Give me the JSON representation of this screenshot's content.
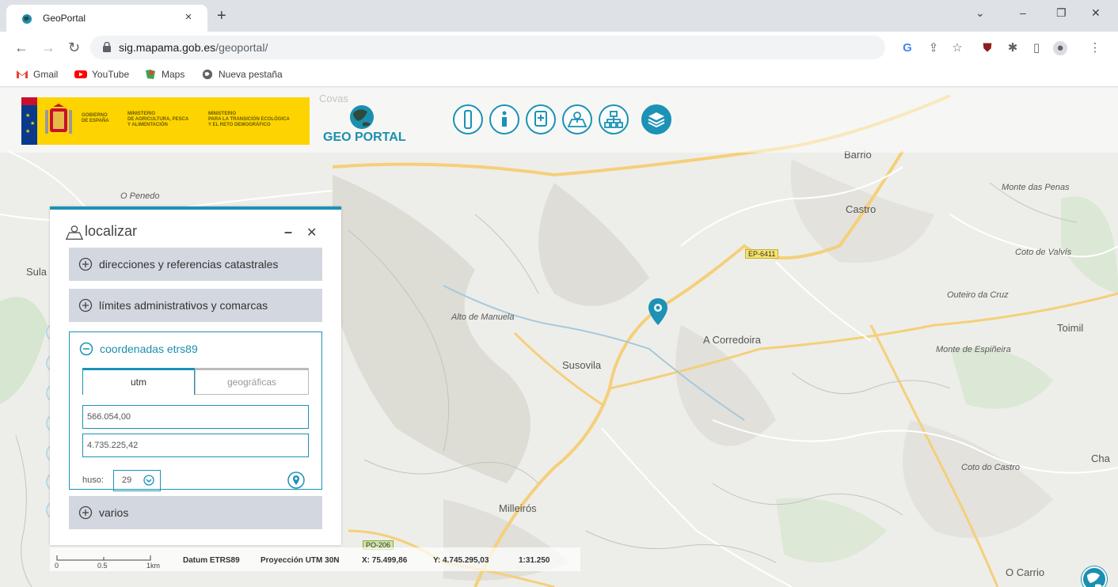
{
  "browser": {
    "tab_title": "GeoPortal",
    "tab_close": "×",
    "new_tab": "+",
    "window_controls": [
      "⌄",
      "–",
      "❐",
      "✕"
    ],
    "url_domain": "sig.mapama.gob.es",
    "url_path": "/geoportal/",
    "bookmarks": [
      "Gmail",
      "YouTube",
      "Maps",
      "Nueva pestaña"
    ]
  },
  "header": {
    "gov_lines": [
      "GOBIERNO DE ESPAÑA",
      "MINISTERIO DE AGRICULTURA, PESCA Y ALIMENTACIÓN",
      "MINISTERIO PARA LA TRANSICIÓN ECOLÓGICA Y EL RETO DEMOGRÁFICO"
    ],
    "gov_1a": "GOBIERNO",
    "gov_1b": "DE ESPAÑA",
    "gov_2a": "MINISTERIO",
    "gov_2b": "DE AGRICULTURA, PESCA",
    "gov_2c": "Y ALIMENTACIÓN",
    "gov_3a": "MINISTERIO",
    "gov_3b": "PARA LA TRANSICIÓN ECOLÓGICA",
    "gov_3c": "Y EL RETO DEMOGRÁFICO",
    "app_name": "GEO PORTAL"
  },
  "map_labels": {
    "covas": "Covas",
    "o_penedo": "O Penedo",
    "barrio": "Barrio",
    "castro": "Castro",
    "monte_das_penas": "Monte das Penas",
    "coto_de_valvis": "Coto de Valvís",
    "outeiro_da_cruz": "Outeiro da Cruz",
    "toimil": "Toimil",
    "alto_de_manuela": "Alto de Manuela",
    "a_corredoira": "A Corredoira",
    "monte_de_espineira": "Monte de Espiñeira",
    "susovila": "Susovila",
    "coto_do_castro": "Coto do Castro",
    "milleiros": "Milleirós",
    "o_carrio": "O Carrio",
    "sula": "Sula",
    "cha": "Cha",
    "road_ep6411": "EP-6411",
    "road_po206": "PO-206"
  },
  "panel": {
    "title": "localizar",
    "minimize": "–",
    "close": "✕",
    "sections": {
      "direcciones": "direcciones y referencias catastrales",
      "limites": "límites administrativos y comarcas",
      "coordenadas": "coordenadas etrs89",
      "varios": "varios"
    },
    "tabs": {
      "utm": "utm",
      "geograficas": "geográficas"
    },
    "x_value": "566.054,00",
    "y_value": "4.735.225,42",
    "huso_label": "huso:",
    "huso_value": "29"
  },
  "infobar": {
    "scale_0": "0",
    "scale_05": "0.5",
    "scale_1km": "1km",
    "datum": "Datum ETRS89",
    "proyeccion": "Proyección UTM 30N",
    "x": "X: 75.499,86",
    "y": "Y: 4.745.295,03",
    "escala": "1:31.250"
  },
  "colors": {
    "accent": "#1b92b6",
    "gov_yellow": "#fdd400"
  }
}
